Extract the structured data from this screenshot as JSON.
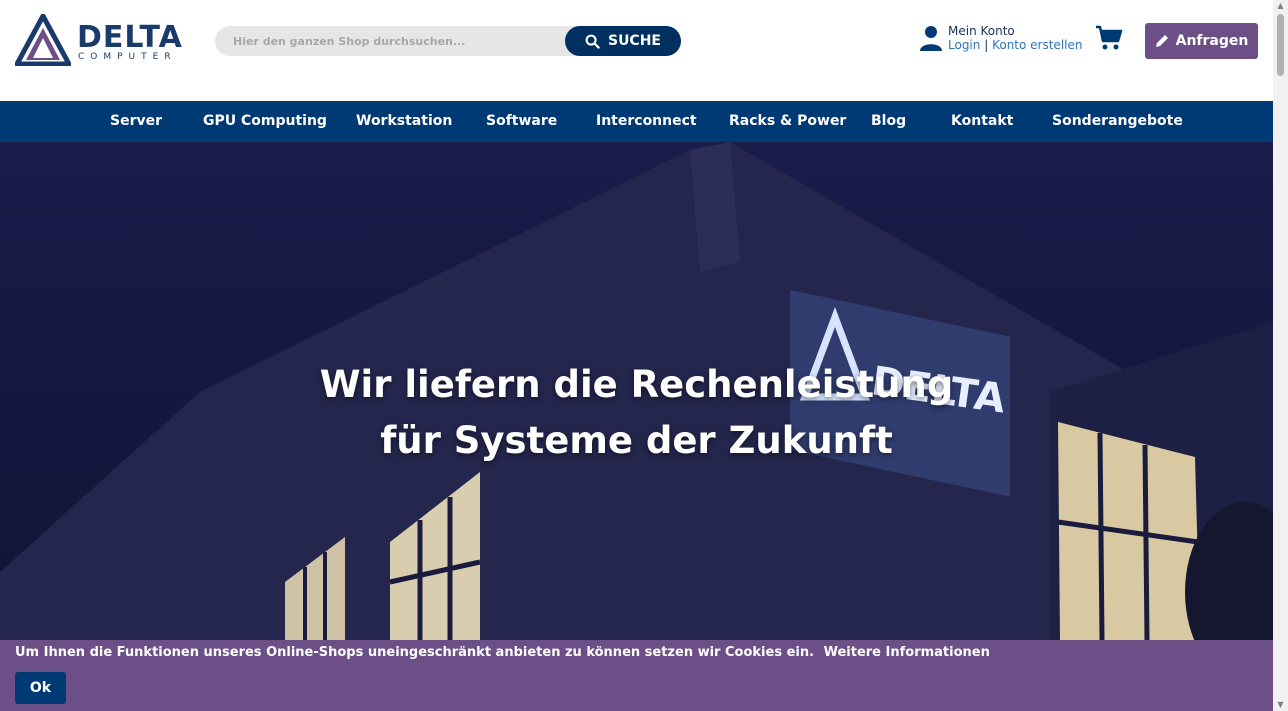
{
  "brand": {
    "name": "DELTA",
    "sub": "COMPUTER",
    "colors": {
      "primary": "#003a74",
      "purple": "#6c4f86"
    }
  },
  "search": {
    "placeholder": "Hier den ganzen Shop durchsuchen...",
    "button_label": "SUCHE",
    "icon": "search-icon"
  },
  "account": {
    "title": "Mein Konto",
    "login": "Login",
    "separator": "|",
    "register": "Konto erstellen",
    "icon": "user-icon"
  },
  "cart": {
    "icon": "cart-icon"
  },
  "anfragen": {
    "label": "Anfragen",
    "icon": "pencil-icon"
  },
  "nav": {
    "items": [
      {
        "label": "Server"
      },
      {
        "label": "GPU Computing"
      },
      {
        "label": "Workstation"
      },
      {
        "label": "Software"
      },
      {
        "label": "Interconnect"
      },
      {
        "label": "Racks & Power"
      },
      {
        "label": "Blog"
      },
      {
        "label": "Kontakt"
      },
      {
        "label": "Sonderangebote"
      }
    ]
  },
  "hero": {
    "line1": "Wir liefern die Rechenleistung",
    "line2": "für Systeme der Zukunft",
    "sign_text": "DELTA"
  },
  "cookie": {
    "text": "Um Ihnen die Funktionen unseres Online-Shops uneingeschränkt anbieten zu können setzen wir Cookies ein.",
    "more": "Weitere Informationen",
    "ok": "Ok"
  }
}
